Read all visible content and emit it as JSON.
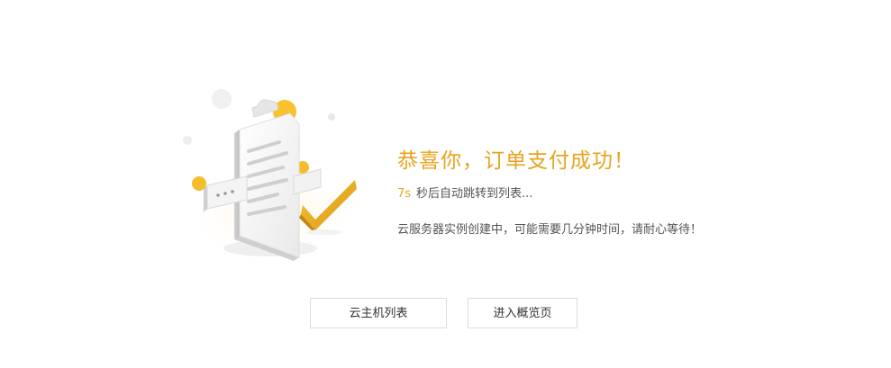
{
  "result": {
    "title": "恭喜你，订单支付成功！",
    "countdown_seconds": "7s",
    "countdown_text": "秒后自动跳转到列表...",
    "note": "云服务器实例创建中，可能需要几分钟时间，请耐心等待！"
  },
  "actions": {
    "host_list_label": "云主机列表",
    "overview_label": "进入概览页"
  },
  "colors": {
    "accent": "#e8a31e",
    "text": "#555555",
    "button_border": "#dcdcdc"
  },
  "icons": {
    "illustration": "success-clipboard-checkmark-illustration"
  }
}
